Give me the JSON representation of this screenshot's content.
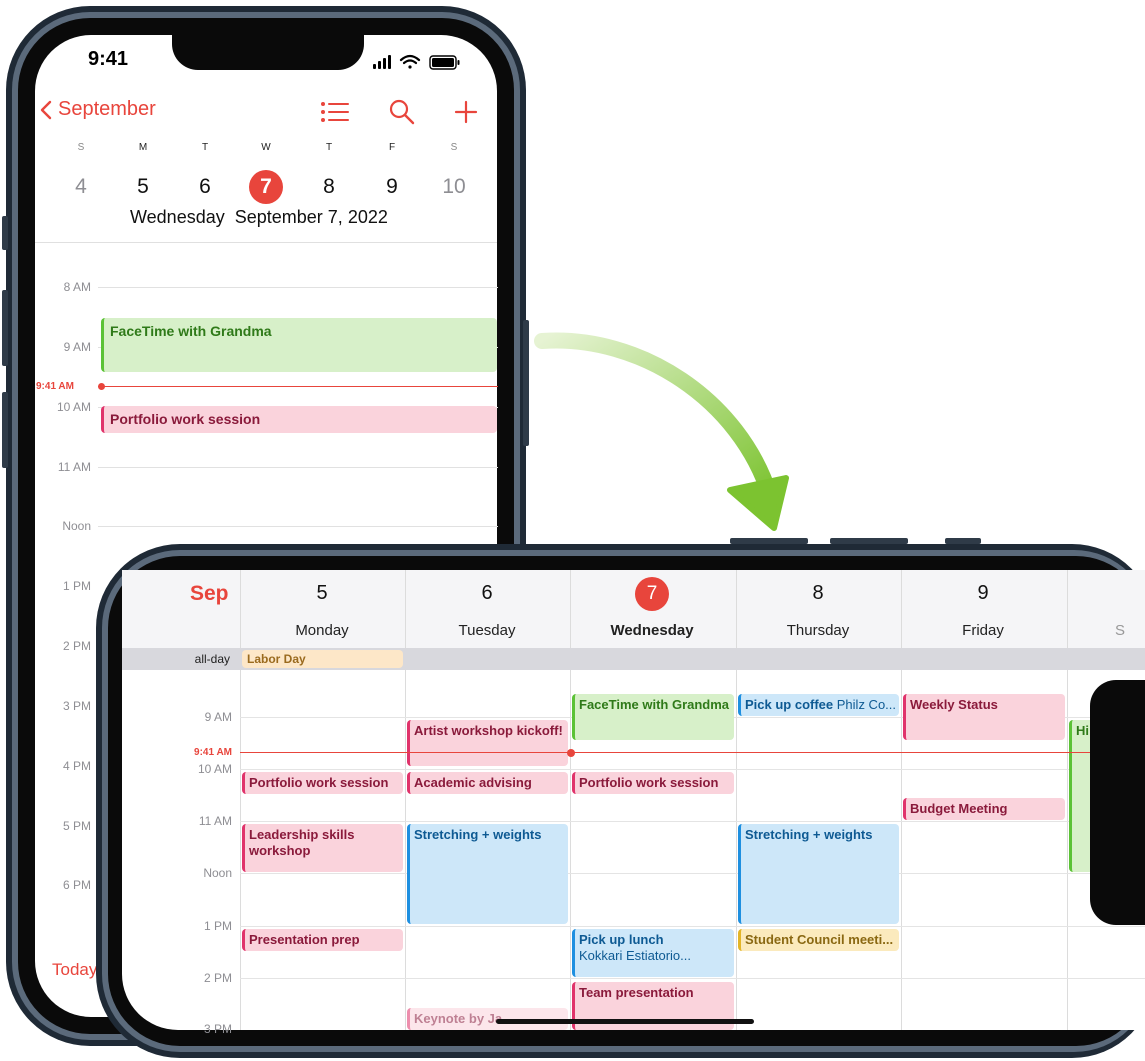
{
  "portrait": {
    "status_time": "9:41",
    "nav": {
      "back_label": "September"
    },
    "week": {
      "letters": [
        "S",
        "M",
        "T",
        "W",
        "T",
        "F",
        "S"
      ],
      "days": [
        "4",
        "5",
        "6",
        "7",
        "8",
        "9",
        "10"
      ],
      "selected_index": 3
    },
    "selected_date": {
      "weekday": "Wednesday",
      "date": "September 7, 2022"
    },
    "hours": [
      "8 AM",
      "9 AM",
      "10 AM",
      "11 AM",
      "Noon",
      "1 PM",
      "2 PM",
      "3 PM",
      "4 PM",
      "5 PM",
      "6 PM"
    ],
    "now_label": "9:41 AM",
    "events": [
      {
        "title": "FaceTime with Grandma",
        "color": "#5bc236"
      },
      {
        "title": "Portfolio work session",
        "color": "#e0336b"
      }
    ],
    "today_label": "Today"
  },
  "landscape": {
    "month": "Sep",
    "allday_label": "all-day",
    "days": [
      {
        "num": "5",
        "name": "Monday"
      },
      {
        "num": "6",
        "name": "Tuesday"
      },
      {
        "num": "7",
        "name": "Wednesday"
      },
      {
        "num": "8",
        "name": "Thursday"
      },
      {
        "num": "9",
        "name": "Friday"
      },
      {
        "num": "",
        "name": "S"
      }
    ],
    "hours": [
      "9 AM",
      "10 AM",
      "11 AM",
      "Noon",
      "1 PM",
      "2 PM",
      "3 PM"
    ],
    "now_label": "9:41 AM",
    "allday_event": "Labor Day",
    "events": {
      "facetime": "FaceTime with Grandma",
      "coffee_title": "Pick up coffee",
      "coffee_loc": "Philz Co...",
      "weekly": "Weekly Status",
      "hi": "Hi",
      "artist": "Artist workshop kickoff!",
      "portfolio_mon": "Portfolio work session",
      "academic": "Academic advising",
      "portfolio_wed": "Portfolio work session",
      "budget": "Budget Meeting",
      "leadership": "Leadership skills workshop",
      "stretch_tue": "Stretching + weights",
      "stretch_thu": "Stretching + weights",
      "presentation": "Presentation prep",
      "lunch_title": "Pick up lunch",
      "lunch_loc": "Kokkari Estiatorio...",
      "student": "Student Council meeti...",
      "team": "Team presentation",
      "keynote": "Keynote by Ja..."
    }
  },
  "colors": {
    "accent": "#e8453c",
    "green": "#5bc236",
    "pink": "#e0336b",
    "blue": "#1e8fe0",
    "yellow": "#e3b527"
  }
}
